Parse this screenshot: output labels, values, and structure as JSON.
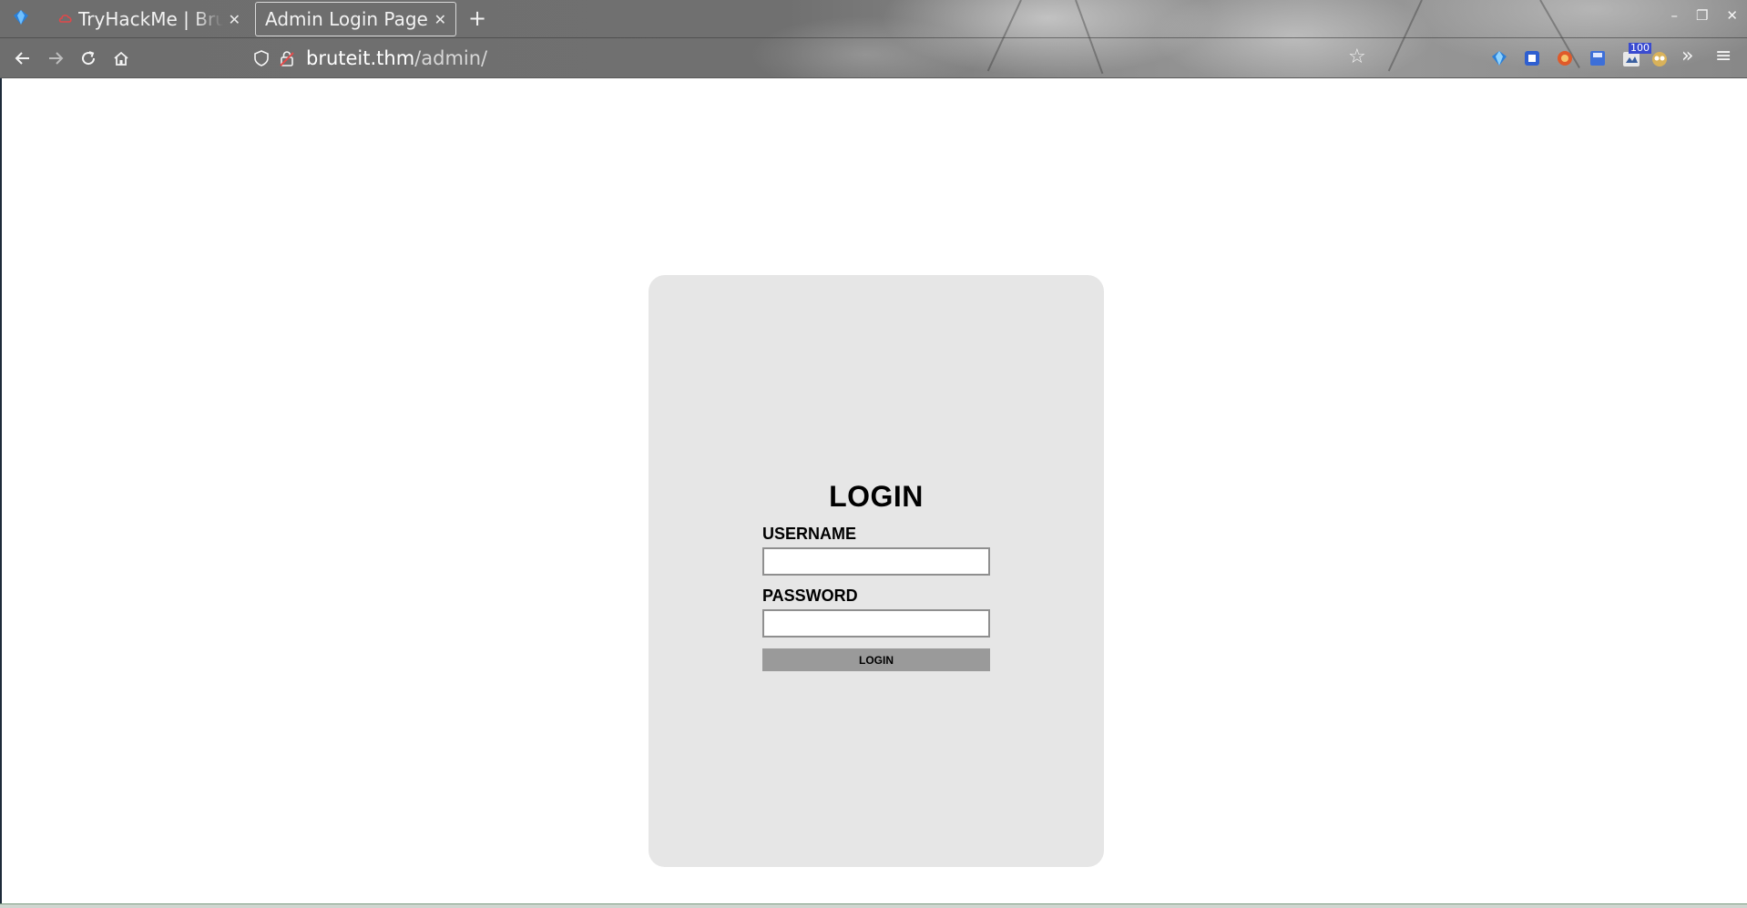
{
  "browser": {
    "tabs": [
      {
        "title": "TryHackMe | Brute It",
        "active": false
      },
      {
        "title": "Admin Login Page",
        "active": true
      }
    ],
    "new_tab": "+",
    "url": {
      "host": "bruteit.thm",
      "path": "/admin/"
    },
    "extension_badge": "100",
    "window_controls": {
      "minimize": "–",
      "restore": "❐",
      "close": "✕"
    }
  },
  "page": {
    "heading": "LOGIN",
    "username_label": "USERNAME",
    "username_value": "",
    "password_label": "PASSWORD",
    "password_value": "",
    "submit_label": "LOGIN"
  },
  "colors": {
    "card_background": "#e6e6e6",
    "button_background": "#9a9a9a",
    "page_background": "#ffffff"
  }
}
